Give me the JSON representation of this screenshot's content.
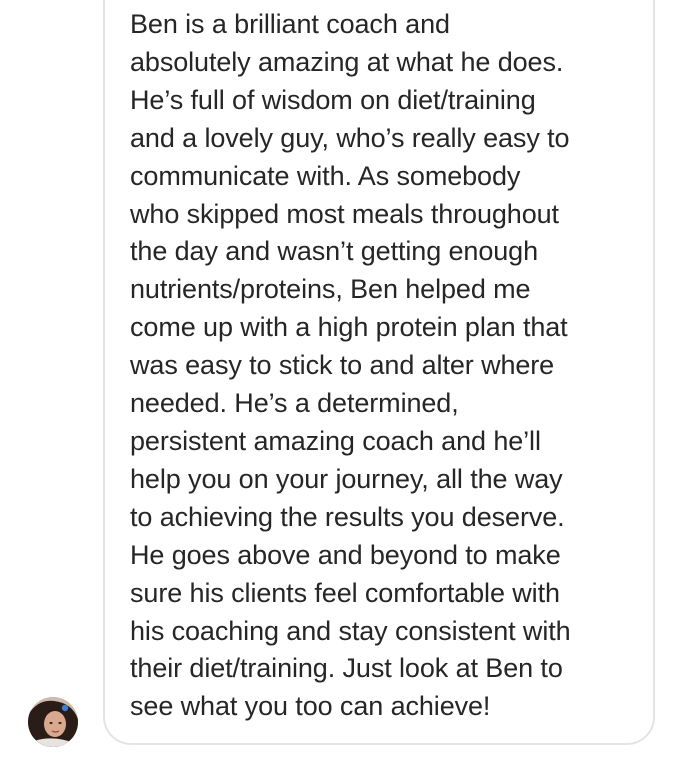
{
  "message": {
    "lines": [
      "Ben is a brilliant coach and",
      "absolutely amazing at what he does.",
      "He’s full of wisdom on diet/training",
      "and a lovely guy, who’s really easy to",
      "communicate with. As somebody",
      "who skipped most meals throughout",
      "the day and wasn’t getting enough",
      "nutrients/proteins, Ben helped me",
      "come up with a high protein plan that",
      "was easy to stick to and alter where",
      "needed. He’s a determined,",
      "persistent amazing coach and he’ll",
      "help you on your journey, all the way",
      "to achieving the results you deserve.",
      "He goes above and beyond to make",
      "sure his clients feel comfortable with",
      "his coaching and stay consistent with",
      "their diet/training. Just look at Ben to",
      "see what you too can achieve!"
    ]
  },
  "sender": {
    "avatar_icon": "profile-photo-avatar"
  },
  "colors": {
    "text": "#262626",
    "bubble_border": "#e4e4e4",
    "background": "#ffffff"
  }
}
